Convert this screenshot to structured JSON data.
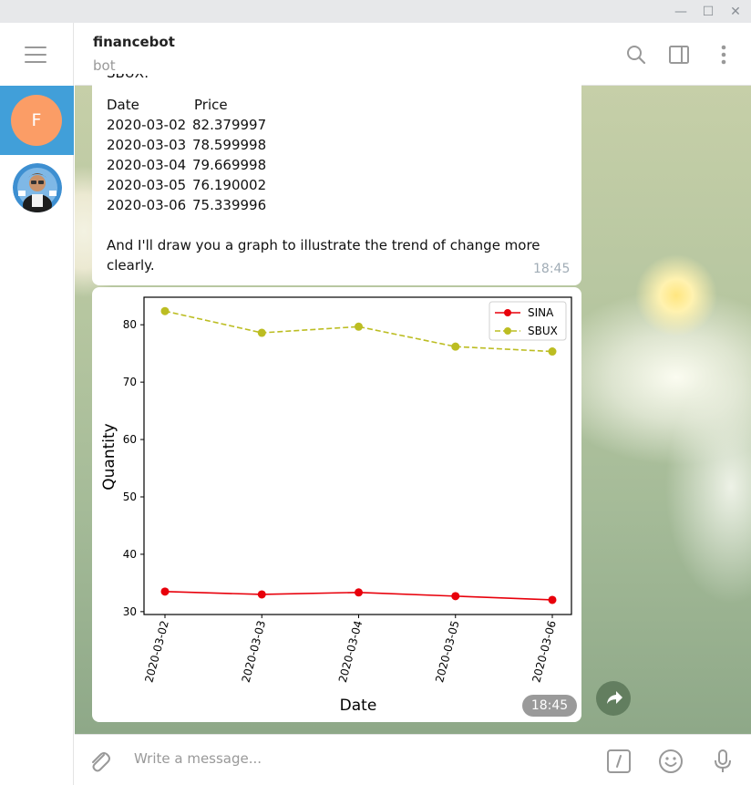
{
  "window": {
    "minimize_glyph": "—",
    "maximize_glyph": "☐",
    "close_glyph": "✕"
  },
  "sidebar": {
    "menu_icon": "hamburger-icon",
    "chats": [
      {
        "initial": "F",
        "color": "#fb9d66",
        "active": true
      },
      {
        "avatar": "bot-avatar-icon",
        "active": false
      }
    ]
  },
  "header": {
    "title": "financebot",
    "subtitle": "bot",
    "icons": [
      "search-icon",
      "sidebar-toggle-icon",
      "more-vertical-icon"
    ]
  },
  "messages": [
    {
      "cut_line": "SBUX:",
      "table_header": {
        "date": "Date",
        "price": "Price"
      },
      "rows": [
        {
          "date": "2020-03-02",
          "price": "82.379997"
        },
        {
          "date": "2020-03-03",
          "price": "78.599998"
        },
        {
          "date": "2020-03-04",
          "price": "79.669998"
        },
        {
          "date": "2020-03-05",
          "price": "76.190002"
        },
        {
          "date": "2020-03-06",
          "price": "75.339996"
        }
      ],
      "text_line1": "And I'll draw you a graph to illustrate the trend of change more",
      "text_line2": "clearly.",
      "time": "18:45"
    },
    {
      "type": "image",
      "time": "18:45"
    }
  ],
  "chart_data": {
    "type": "line",
    "categories": [
      "2020-03-02",
      "2020-03-03",
      "2020-03-04",
      "2020-03-05",
      "2020-03-06"
    ],
    "series": [
      {
        "name": "SINA",
        "values": [
          33.5,
          33.0,
          33.35,
          32.7,
          32.05
        ],
        "color": "#e8000b",
        "style": "solid"
      },
      {
        "name": "SBUX",
        "values": [
          82.38,
          78.6,
          79.67,
          76.19,
          75.34
        ],
        "color": "#bcbd22",
        "style": "dashed"
      }
    ],
    "xlabel": "Date",
    "ylabel": "Quantity",
    "yticks": [
      30,
      40,
      50,
      60,
      70,
      80
    ],
    "ylim": [
      29.5,
      84.8
    ],
    "legend": "top-right",
    "grid": false
  },
  "footer": {
    "placeholder": "Write a message...",
    "icons": [
      "attach-icon",
      "bot-command-icon",
      "emoji-icon",
      "microphone-icon"
    ]
  }
}
